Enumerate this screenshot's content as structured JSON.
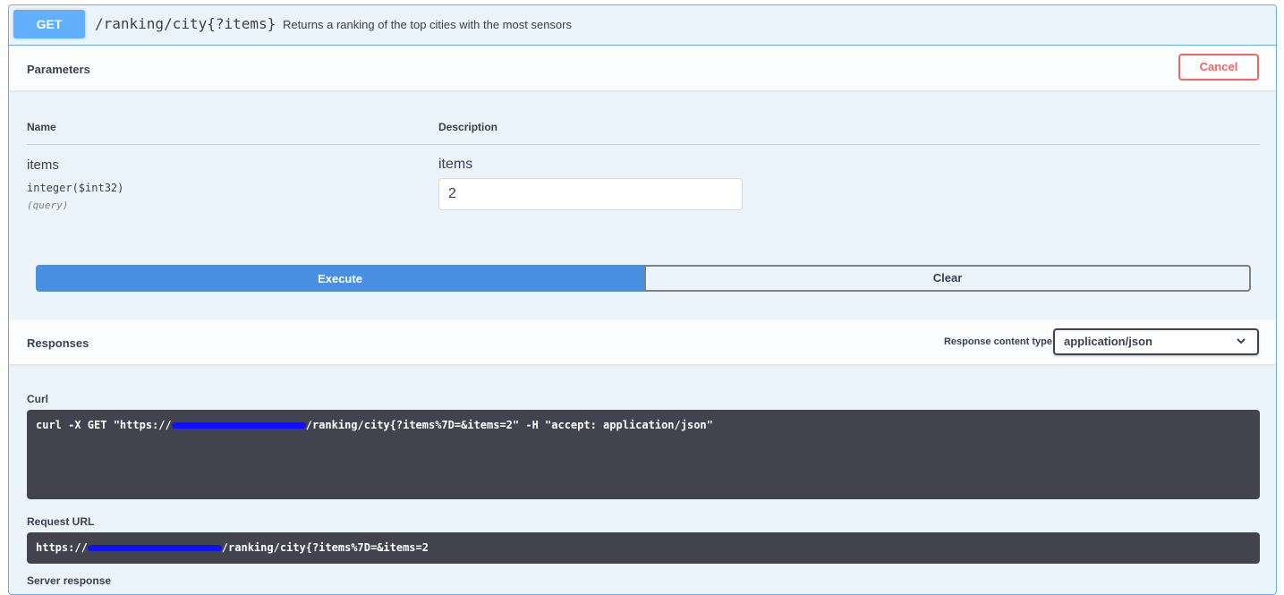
{
  "operation": {
    "method": "GET",
    "path": "/ranking/city{?items}",
    "summary": "Returns a ranking of the top cities with the most sensors"
  },
  "parameters": {
    "title": "Parameters",
    "cancel_label": "Cancel",
    "col_name": "Name",
    "col_description": "Description",
    "items": [
      {
        "name": "items",
        "type": "integer($int32)",
        "in": "(query)",
        "description": "items",
        "value": "2"
      }
    ]
  },
  "actions": {
    "execute_label": "Execute",
    "clear_label": "Clear"
  },
  "responses": {
    "title": "Responses",
    "content_type_label": "Response content type",
    "content_type_value": "application/json",
    "chevron": "chevron-down-icon"
  },
  "curl": {
    "title": "Curl",
    "prefix": "curl -X GET \"https://",
    "suffix": "/ranking/city{?items%7D=&items=2\" -H \"accept: application/json\""
  },
  "request_url": {
    "title": "Request URL",
    "prefix": "https://",
    "suffix": "/ranking/city{?items%7D=&items=2"
  },
  "server_response": {
    "title": "Server response"
  },
  "colors": {
    "get": "#61affe",
    "execute": "#4990e2",
    "cancel": "#ff6060",
    "code_bg": "#41444e"
  }
}
